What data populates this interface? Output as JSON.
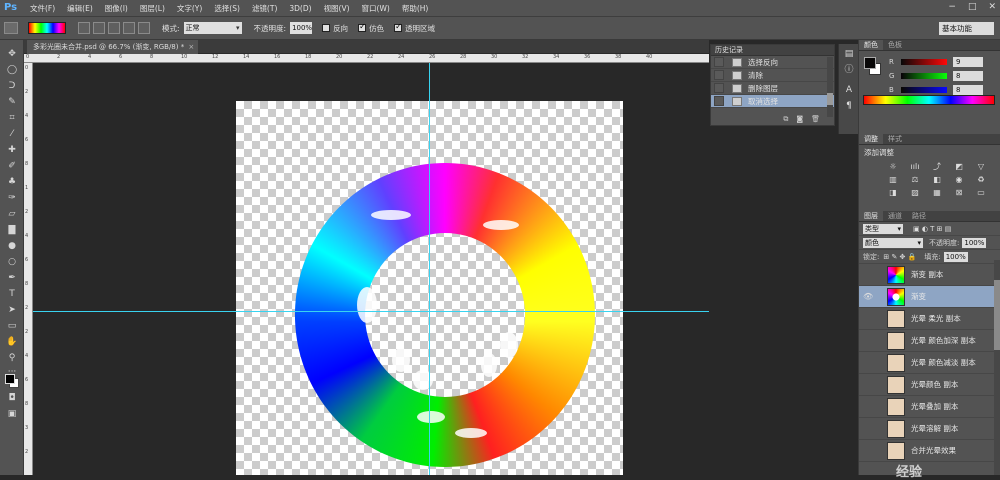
{
  "menubar": {
    "logo": "Ps",
    "items": [
      "文件(F)",
      "编辑(E)",
      "图像(I)",
      "图层(L)",
      "文字(Y)",
      "选择(S)",
      "滤镜(T)",
      "3D(D)",
      "视图(V)",
      "窗口(W)",
      "帮助(H)"
    ],
    "window_controls": [
      "−",
      "□",
      "✕"
    ]
  },
  "options": {
    "mode_label": "模式:",
    "mode_value": "正常",
    "opacity_label": "不透明度:",
    "opacity_value": "100%",
    "reverse_label": "反向",
    "dither_label": "仿色",
    "transparency_label": "透明区域",
    "workspace": "基本功能"
  },
  "document": {
    "tab_title": "多彩光圈未合并.psd @ 66.7% (渐变, RGB/8) *",
    "close": "×"
  },
  "ruler": {
    "h_ticks": [
      "0",
      "2",
      "4",
      "6",
      "8",
      "10",
      "12",
      "14",
      "16",
      "18",
      "20",
      "22",
      "24",
      "26",
      "28",
      "30",
      "32",
      "34",
      "36",
      "38",
      "40"
    ],
    "v_ticks": [
      "0",
      "2",
      "4",
      "6",
      "8",
      "1",
      "2",
      "4",
      "6",
      "8",
      "2",
      "2",
      "4",
      "6",
      "8",
      "3",
      "2"
    ]
  },
  "history": {
    "title": "历史记录",
    "items": [
      {
        "label": "选择反向",
        "selected": false
      },
      {
        "label": "清除",
        "selected": false
      },
      {
        "label": "删除图层",
        "selected": false
      },
      {
        "label": "取消选择",
        "selected": true
      }
    ]
  },
  "color_panel": {
    "tabs": [
      "颜色",
      "色板"
    ],
    "channels": [
      {
        "name": "R",
        "value": "9"
      },
      {
        "name": "G",
        "value": "8"
      },
      {
        "name": "B",
        "value": "8"
      }
    ]
  },
  "adjust_panel": {
    "tabs": [
      "调整",
      "样式"
    ],
    "heading": "添加调整"
  },
  "layers_panel": {
    "tabs": [
      "图层",
      "通道",
      "路径"
    ],
    "filter_label": "类型",
    "blend_mode": "颜色",
    "opacity_label": "不透明度:",
    "opacity_value": "100%",
    "lock_label": "锁定:",
    "fill_label": "填充:",
    "fill_value": "100%",
    "layers": [
      {
        "name": "渐变 副本",
        "thumb": "grad",
        "visible": false,
        "selected": false
      },
      {
        "name": "渐变",
        "thumb": "ring",
        "visible": true,
        "selected": true
      },
      {
        "name": "光晕 柔光 副本",
        "thumb": "beige",
        "visible": false,
        "selected": false
      },
      {
        "name": "光晕 颜色加深 副本",
        "thumb": "beige",
        "visible": false,
        "selected": false
      },
      {
        "name": "光晕 颜色减淡 副本",
        "thumb": "beige",
        "visible": false,
        "selected": false
      },
      {
        "name": "光晕颜色 副本",
        "thumb": "beige",
        "visible": false,
        "selected": false
      },
      {
        "name": "光晕叠加 副本",
        "thumb": "beige",
        "visible": false,
        "selected": false
      },
      {
        "name": "光晕溶解 副本",
        "thumb": "beige",
        "visible": false,
        "selected": false
      },
      {
        "name": "合并光晕效果",
        "thumb": "beige",
        "visible": false,
        "selected": false
      }
    ]
  },
  "watermark": "经验"
}
